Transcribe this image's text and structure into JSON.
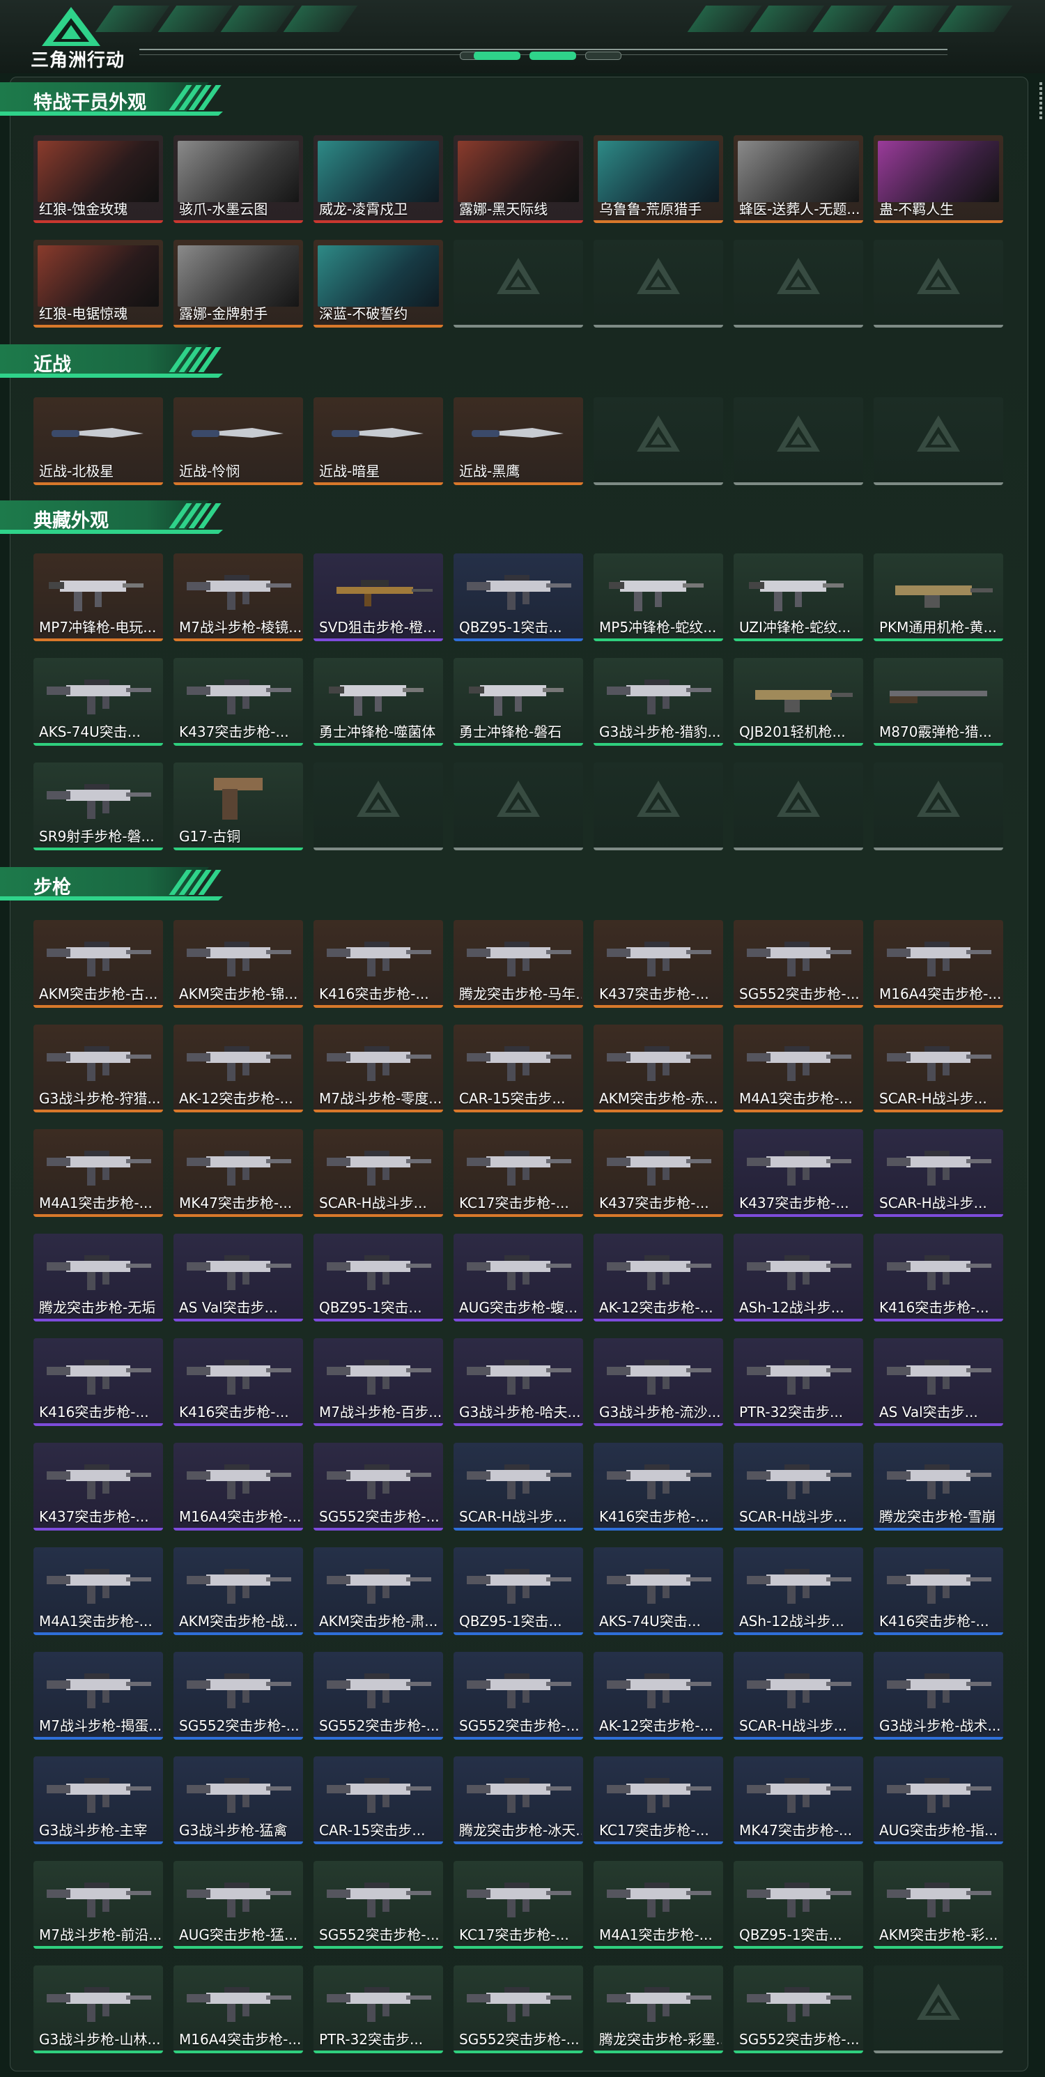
{
  "header": {
    "title": "三角洲行动"
  },
  "colors": {
    "accent": "#2fd38a",
    "orange": "#d8782b",
    "red": "#c8372f",
    "purple": "#7d4cdb",
    "blue": "#2f6fd8",
    "green": "#2fcf7e"
  },
  "sections": [
    {
      "title": "特战干员外观",
      "items": [
        {
          "name": "红狼-蚀金玫瑰",
          "rarity": "red",
          "icon": "operator-portrait"
        },
        {
          "name": "骇爪-水墨云图",
          "rarity": "red",
          "icon": "operator-portrait"
        },
        {
          "name": "威龙-凌霄戍卫",
          "rarity": "red",
          "icon": "operator-portrait"
        },
        {
          "name": "露娜-黑天际线",
          "rarity": "red",
          "icon": "operator-portrait"
        },
        {
          "name": "乌鲁鲁-荒原猎手",
          "rarity": "orange",
          "icon": "operator-portrait"
        },
        {
          "name": "蜂医-送葬人-无题...",
          "rarity": "orange",
          "icon": "operator-portrait"
        },
        {
          "name": "蛊-不羁人生",
          "rarity": "orange",
          "icon": "operator-portrait"
        },
        {
          "name": "红狼-电锯惊魂",
          "rarity": "orange",
          "icon": "operator-portrait"
        },
        {
          "name": "露娜-金牌射手",
          "rarity": "orange",
          "icon": "operator-portrait"
        },
        {
          "name": "深蓝-不破誓约",
          "rarity": "orange",
          "icon": "operator-portrait"
        },
        {
          "name": "",
          "rarity": "empty",
          "icon": "delta-logo-icon"
        },
        {
          "name": "",
          "rarity": "empty",
          "icon": "delta-logo-icon"
        },
        {
          "name": "",
          "rarity": "empty",
          "icon": "delta-logo-icon"
        },
        {
          "name": "",
          "rarity": "empty",
          "icon": "delta-logo-icon"
        }
      ]
    },
    {
      "title": "近战",
      "items": [
        {
          "name": "近战-北极星",
          "rarity": "orange",
          "icon": "knife-icon"
        },
        {
          "name": "近战-怜悯",
          "rarity": "orange",
          "icon": "knife-icon"
        },
        {
          "name": "近战-暗星",
          "rarity": "orange",
          "icon": "knife-icon"
        },
        {
          "name": "近战-黑鹰",
          "rarity": "orange",
          "icon": "knife-icon"
        },
        {
          "name": "",
          "rarity": "empty",
          "icon": "delta-logo-icon"
        },
        {
          "name": "",
          "rarity": "empty",
          "icon": "delta-logo-icon"
        },
        {
          "name": "",
          "rarity": "empty",
          "icon": "delta-logo-icon"
        }
      ]
    },
    {
      "title": "典藏外观",
      "items": [
        {
          "name": "MP7冲锋枪-电玩...",
          "rarity": "orange",
          "icon": "smg-icon"
        },
        {
          "name": "M7战斗步枪-棱镜...",
          "rarity": "orange",
          "icon": "rifle-icon"
        },
        {
          "name": "SVD狙击步枪-橙...",
          "rarity": "purple",
          "icon": "sniper-icon"
        },
        {
          "name": "QBZ95-1突击...",
          "rarity": "blue",
          "icon": "rifle-icon"
        },
        {
          "name": "MP5冲锋枪-蛇纹...",
          "rarity": "green",
          "icon": "smg-icon"
        },
        {
          "name": "UZI冲锋枪-蛇纹...",
          "rarity": "green",
          "icon": "smg-icon"
        },
        {
          "name": "PKM通用机枪-黄...",
          "rarity": "green",
          "icon": "lmg-icon"
        },
        {
          "name": "AKS-74U突击...",
          "rarity": "green",
          "icon": "rifle-icon"
        },
        {
          "name": "K437突击步枪-...",
          "rarity": "green",
          "icon": "rifle-icon"
        },
        {
          "name": "勇士冲锋枪-噬菌体",
          "rarity": "green",
          "icon": "smg-icon"
        },
        {
          "name": "勇士冲锋枪-磐石",
          "rarity": "green",
          "icon": "smg-icon"
        },
        {
          "name": "G3战斗步枪-猎豹...",
          "rarity": "green",
          "icon": "rifle-icon"
        },
        {
          "name": "QJB201轻机枪...",
          "rarity": "green",
          "icon": "lmg-icon"
        },
        {
          "name": "M870霰弹枪-猎...",
          "rarity": "green",
          "icon": "shotgun-icon"
        },
        {
          "name": "SR9射手步枪-磐...",
          "rarity": "green",
          "icon": "rifle-icon"
        },
        {
          "name": "G17-古铜",
          "rarity": "green",
          "icon": "pistol-icon"
        },
        {
          "name": "",
          "rarity": "empty",
          "icon": "delta-logo-icon"
        },
        {
          "name": "",
          "rarity": "empty",
          "icon": "delta-logo-icon"
        },
        {
          "name": "",
          "rarity": "empty",
          "icon": "delta-logo-icon"
        },
        {
          "name": "",
          "rarity": "empty",
          "icon": "delta-logo-icon"
        },
        {
          "name": "",
          "rarity": "empty",
          "icon": "delta-logo-icon"
        }
      ]
    },
    {
      "title": "步枪",
      "items": [
        {
          "name": "AKM突击步枪-古...",
          "rarity": "orange",
          "icon": "rifle-icon"
        },
        {
          "name": "AKM突击步枪-锦...",
          "rarity": "orange",
          "icon": "rifle-icon"
        },
        {
          "name": "K416突击步枪-...",
          "rarity": "orange",
          "icon": "rifle-icon"
        },
        {
          "name": "腾龙突击步枪-马年...",
          "rarity": "orange",
          "icon": "rifle-icon"
        },
        {
          "name": "K437突击步枪-...",
          "rarity": "orange",
          "icon": "rifle-icon"
        },
        {
          "name": "SG552突击步枪-...",
          "rarity": "orange",
          "icon": "rifle-icon"
        },
        {
          "name": "M16A4突击步枪-...",
          "rarity": "orange",
          "icon": "rifle-icon"
        },
        {
          "name": "G3战斗步枪-狩猎...",
          "rarity": "orange",
          "icon": "rifle-icon"
        },
        {
          "name": "AK-12突击步枪-...",
          "rarity": "orange",
          "icon": "rifle-icon"
        },
        {
          "name": "M7战斗步枪-零度...",
          "rarity": "orange",
          "icon": "rifle-icon"
        },
        {
          "name": "CAR-15突击步...",
          "rarity": "orange",
          "icon": "rifle-icon"
        },
        {
          "name": "AKM突击步枪-赤...",
          "rarity": "orange",
          "icon": "rifle-icon"
        },
        {
          "name": "M4A1突击步枪-...",
          "rarity": "orange",
          "icon": "rifle-icon"
        },
        {
          "name": "SCAR-H战斗步...",
          "rarity": "orange",
          "icon": "rifle-icon"
        },
        {
          "name": "M4A1突击步枪-...",
          "rarity": "orange",
          "icon": "rifle-icon"
        },
        {
          "name": "MK47突击步枪-...",
          "rarity": "orange",
          "icon": "rifle-icon"
        },
        {
          "name": "SCAR-H战斗步...",
          "rarity": "orange",
          "icon": "rifle-icon"
        },
        {
          "name": "KC17突击步枪-...",
          "rarity": "orange",
          "icon": "rifle-icon"
        },
        {
          "name": "K437突击步枪-...",
          "rarity": "orange",
          "icon": "rifle-icon"
        },
        {
          "name": "K437突击步枪-...",
          "rarity": "purple",
          "icon": "rifle-icon"
        },
        {
          "name": "SCAR-H战斗步...",
          "rarity": "purple",
          "icon": "rifle-icon"
        },
        {
          "name": "腾龙突击步枪-无垢",
          "rarity": "purple",
          "icon": "rifle-icon"
        },
        {
          "name": "AS Val突击步...",
          "rarity": "purple",
          "icon": "rifle-icon"
        },
        {
          "name": "QBZ95-1突击...",
          "rarity": "purple",
          "icon": "rifle-icon"
        },
        {
          "name": "AUG突击步枪-蝮...",
          "rarity": "purple",
          "icon": "rifle-icon"
        },
        {
          "name": "AK-12突击步枪-...",
          "rarity": "purple",
          "icon": "rifle-icon"
        },
        {
          "name": "ASh-12战斗步...",
          "rarity": "purple",
          "icon": "rifle-icon"
        },
        {
          "name": "K416突击步枪-...",
          "rarity": "purple",
          "icon": "rifle-icon"
        },
        {
          "name": "K416突击步枪-...",
          "rarity": "purple",
          "icon": "rifle-icon"
        },
        {
          "name": "K416突击步枪-...",
          "rarity": "purple",
          "icon": "rifle-icon"
        },
        {
          "name": "M7战斗步枪-百步...",
          "rarity": "purple",
          "icon": "rifle-icon"
        },
        {
          "name": "G3战斗步枪-哈夫...",
          "rarity": "purple",
          "icon": "rifle-icon"
        },
        {
          "name": "G3战斗步枪-流沙...",
          "rarity": "purple",
          "icon": "rifle-icon"
        },
        {
          "name": "PTR-32突击步...",
          "rarity": "purple",
          "icon": "rifle-icon"
        },
        {
          "name": "AS Val突击步...",
          "rarity": "purple",
          "icon": "rifle-icon"
        },
        {
          "name": "K437突击步枪-...",
          "rarity": "purple",
          "icon": "rifle-icon"
        },
        {
          "name": "M16A4突击步枪-...",
          "rarity": "purple",
          "icon": "rifle-icon"
        },
        {
          "name": "SG552突击步枪-...",
          "rarity": "purple",
          "icon": "rifle-icon"
        },
        {
          "name": "SCAR-H战斗步...",
          "rarity": "blue",
          "icon": "rifle-icon"
        },
        {
          "name": "K416突击步枪-...",
          "rarity": "blue",
          "icon": "rifle-icon"
        },
        {
          "name": "SCAR-H战斗步...",
          "rarity": "blue",
          "icon": "rifle-icon"
        },
        {
          "name": "腾龙突击步枪-雪崩",
          "rarity": "blue",
          "icon": "rifle-icon"
        },
        {
          "name": "M4A1突击步枪-...",
          "rarity": "blue",
          "icon": "rifle-icon"
        },
        {
          "name": "AKM突击步枪-战...",
          "rarity": "blue",
          "icon": "rifle-icon"
        },
        {
          "name": "AKM突击步枪-肃...",
          "rarity": "blue",
          "icon": "rifle-icon"
        },
        {
          "name": "QBZ95-1突击...",
          "rarity": "blue",
          "icon": "rifle-icon"
        },
        {
          "name": "AKS-74U突击...",
          "rarity": "blue",
          "icon": "rifle-icon"
        },
        {
          "name": "ASh-12战斗步...",
          "rarity": "blue",
          "icon": "rifle-icon"
        },
        {
          "name": "K416突击步枪-...",
          "rarity": "blue",
          "icon": "rifle-icon"
        },
        {
          "name": "M7战斗步枪-揭蛋...",
          "rarity": "blue",
          "icon": "rifle-icon"
        },
        {
          "name": "SG552突击步枪-...",
          "rarity": "blue",
          "icon": "rifle-icon"
        },
        {
          "name": "SG552突击步枪-...",
          "rarity": "blue",
          "icon": "rifle-icon"
        },
        {
          "name": "SG552突击步枪-...",
          "rarity": "blue",
          "icon": "rifle-icon"
        },
        {
          "name": "AK-12突击步枪-...",
          "rarity": "blue",
          "icon": "rifle-icon"
        },
        {
          "name": "SCAR-H战斗步...",
          "rarity": "blue",
          "icon": "rifle-icon"
        },
        {
          "name": "G3战斗步枪-战术...",
          "rarity": "blue",
          "icon": "rifle-icon"
        },
        {
          "name": "G3战斗步枪-主宰",
          "rarity": "blue",
          "icon": "rifle-icon"
        },
        {
          "name": "G3战斗步枪-猛禽",
          "rarity": "blue",
          "icon": "rifle-icon"
        },
        {
          "name": "CAR-15突击步...",
          "rarity": "blue",
          "icon": "rifle-icon"
        },
        {
          "name": "腾龙突击步枪-冰天...",
          "rarity": "blue",
          "icon": "rifle-icon"
        },
        {
          "name": "KC17突击步枪-...",
          "rarity": "blue",
          "icon": "rifle-icon"
        },
        {
          "name": "MK47突击步枪-...",
          "rarity": "blue",
          "icon": "rifle-icon"
        },
        {
          "name": "AUG突击步枪-指...",
          "rarity": "blue",
          "icon": "rifle-icon"
        },
        {
          "name": "M7战斗步枪-前沿...",
          "rarity": "green",
          "icon": "rifle-icon"
        },
        {
          "name": "AUG突击步枪-猛...",
          "rarity": "green",
          "icon": "rifle-icon"
        },
        {
          "name": "SG552突击步枪-...",
          "rarity": "green",
          "icon": "rifle-icon"
        },
        {
          "name": "KC17突击步枪-...",
          "rarity": "green",
          "icon": "rifle-icon"
        },
        {
          "name": "M4A1突击步枪-...",
          "rarity": "green",
          "icon": "rifle-icon"
        },
        {
          "name": "QBZ95-1突击...",
          "rarity": "green",
          "icon": "rifle-icon"
        },
        {
          "name": "AKM突击步枪-彩...",
          "rarity": "green",
          "icon": "rifle-icon"
        },
        {
          "name": "G3战斗步枪-山林...",
          "rarity": "green",
          "icon": "rifle-icon"
        },
        {
          "name": "M16A4突击步枪-...",
          "rarity": "green",
          "icon": "rifle-icon"
        },
        {
          "name": "PTR-32突击步...",
          "rarity": "green",
          "icon": "rifle-icon"
        },
        {
          "name": "SG552突击步枪-...",
          "rarity": "green",
          "icon": "rifle-icon"
        },
        {
          "name": "腾龙突击步枪-彩墨...",
          "rarity": "green",
          "icon": "rifle-icon"
        },
        {
          "name": "SG552突击步枪-...",
          "rarity": "green",
          "icon": "rifle-icon"
        },
        {
          "name": "",
          "rarity": "empty",
          "icon": "delta-logo-icon"
        }
      ]
    }
  ]
}
